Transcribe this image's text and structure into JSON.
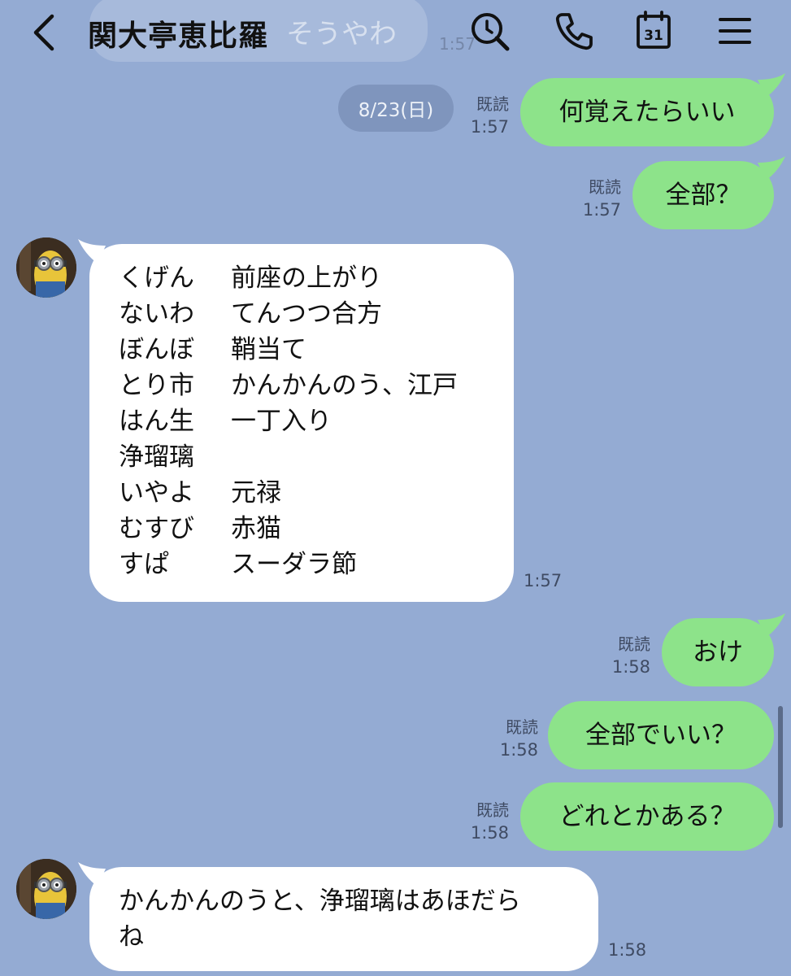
{
  "header": {
    "title": "関大亭恵比羅",
    "ghost_text": "そうやわ",
    "ghost_time": "1:57",
    "calendar_day": "31"
  },
  "date_separator": "8/23(日)",
  "messages": [
    {
      "dir": "out",
      "text": "何覚えたらいい",
      "read": "既読",
      "time": "1:57"
    },
    {
      "dir": "out",
      "text": "全部？",
      "read": "既読",
      "time": "1:57"
    },
    {
      "dir": "in",
      "time": "1:57",
      "rows": [
        {
          "k": "くげん",
          "v": "前座の上がり"
        },
        {
          "k": "ないわ",
          "v": "てんつつ合方"
        },
        {
          "k": "ぼんぼ",
          "v": "鞘当て"
        },
        {
          "k": "とり市",
          "v": "かんかんのう、江戸"
        },
        {
          "k": "はん生",
          "v": "一丁入り"
        },
        {
          "k": "浄瑠璃",
          "v": ""
        },
        {
          "k": "いやよ",
          "v": "元禄"
        },
        {
          "k": "むすび",
          "v": "赤猫"
        },
        {
          "k": "すぱ",
          "v": "スーダラ節"
        }
      ]
    },
    {
      "dir": "out",
      "text": "おけ",
      "read": "既読",
      "time": "1:58"
    },
    {
      "dir": "out",
      "text": "全部でいい？",
      "read": "既読",
      "time": "1:58"
    },
    {
      "dir": "out",
      "text": "どれとかある？",
      "read": "既読",
      "time": "1:58"
    },
    {
      "dir": "in",
      "time": "1:58",
      "lines": [
        "かんかんのうと、浄瑠璃はあほだら",
        "ね"
      ]
    }
  ],
  "colors": {
    "background": "#94abd3",
    "outgoing_bubble": "#8de38a",
    "incoming_bubble": "#ffffff",
    "date_pill": "#7f95bd"
  },
  "icons": {
    "back": "chevron-left-icon",
    "search": "search-icon",
    "call": "phone-icon",
    "calendar": "calendar-icon",
    "menu": "menu-icon"
  }
}
